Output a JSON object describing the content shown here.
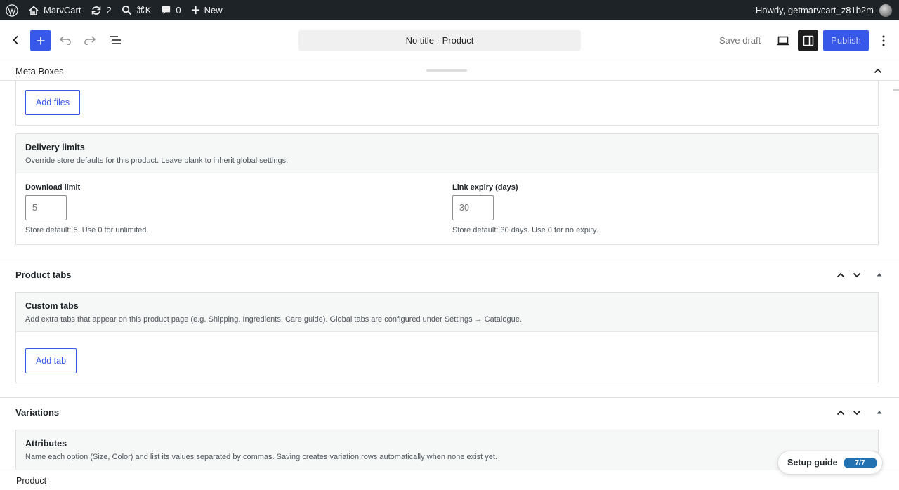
{
  "admin_bar": {
    "site_name": "MarvCart",
    "updates_count": "2",
    "search_shortcut": "⌘K",
    "comments_count": "0",
    "new_label": "New",
    "greeting": "Howdy, getmarvcart_z81b2m"
  },
  "editor_header": {
    "document_title": "No title · Product",
    "save_draft_label": "Save draft",
    "publish_label": "Publish"
  },
  "meta_boxes": {
    "title": "Meta Boxes"
  },
  "downloads": {
    "add_files_label": "Add files"
  },
  "delivery_limits": {
    "title": "Delivery limits",
    "description": "Override store defaults for this product. Leave blank to inherit global settings.",
    "download_limit_label": "Download limit",
    "download_limit_placeholder": "5",
    "download_limit_help": "Store default: 5. Use 0 for unlimited.",
    "link_expiry_label": "Link expiry (days)",
    "link_expiry_placeholder": "30",
    "link_expiry_help": "Store default: 30 days. Use 0 for no expiry."
  },
  "product_tabs": {
    "section_title": "Product tabs",
    "card_title": "Custom tabs",
    "card_description": "Add extra tabs that appear on this product page (e.g. Shipping, Ingredients, Care guide). Global tabs are configured under Settings → Catalogue.",
    "add_tab_label": "Add tab"
  },
  "variations": {
    "section_title": "Variations",
    "card_title": "Attributes",
    "card_description": "Name each option (Size, Color) and list its values separated by commas. Saving creates variation rows automatically when none exist yet."
  },
  "footer": {
    "breadcrumb": "Product"
  },
  "setup_guide": {
    "label": "Setup guide",
    "progress": "7/7"
  },
  "colors": {
    "accent": "#3858e9",
    "admin_bar_bg": "#1d2327",
    "badge": "#2271b1"
  }
}
